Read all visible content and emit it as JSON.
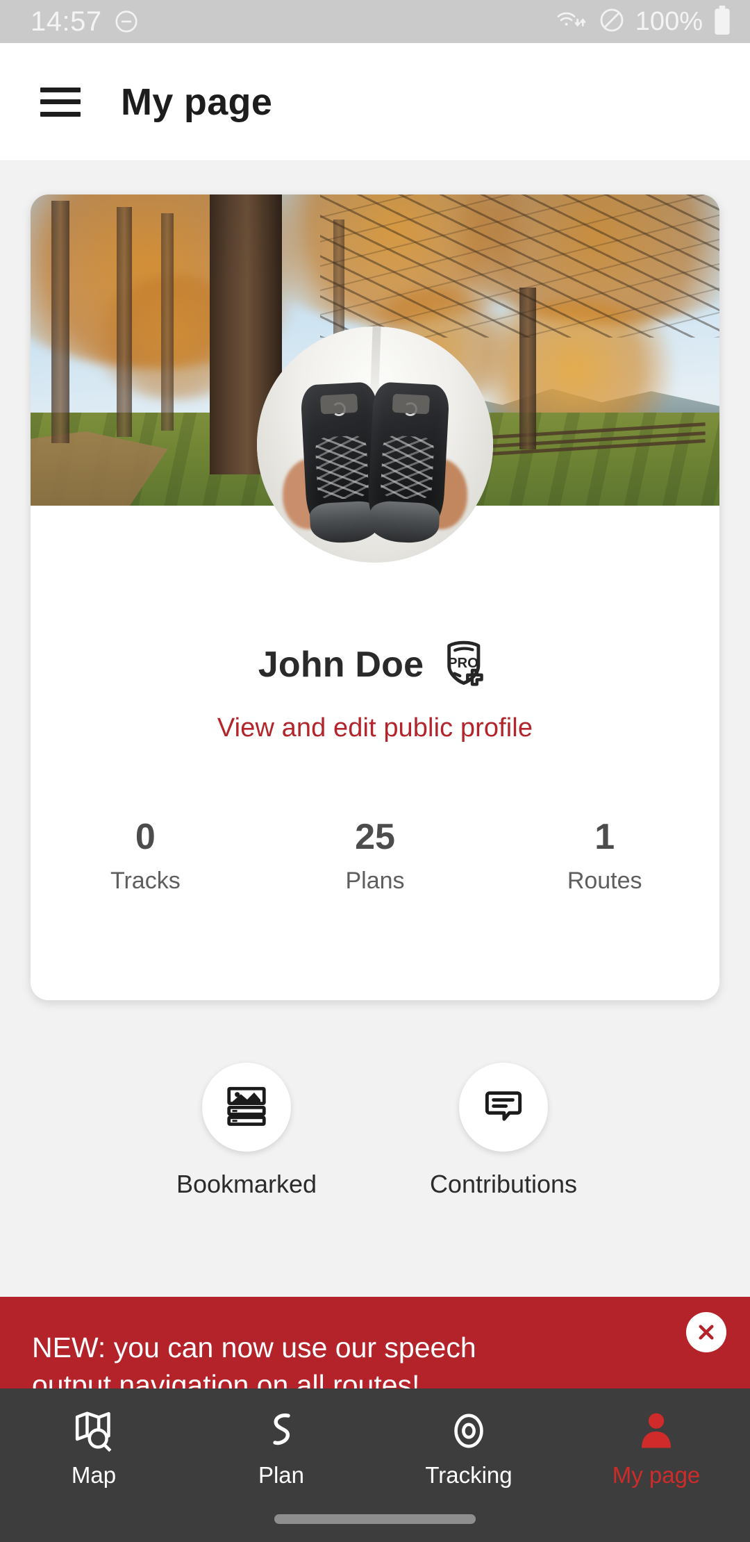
{
  "status_bar": {
    "time": "14:57",
    "dnd_icon": "do-not-disturb-icon",
    "wifi_icon": "wifi-transfer-icon",
    "silent_icon": "mute-circle-slash-icon",
    "battery_percent": "100%",
    "battery_icon": "battery-full-icon",
    "background_color": "#cacaca"
  },
  "app_bar": {
    "menu_icon": "hamburger-menu-icon",
    "title": "My page"
  },
  "profile_card": {
    "cover_photo_alt": "autumn larch forest with path and mountain view",
    "avatar_alt": "hands holding black hiking boots",
    "name": "John Doe",
    "pro_badge": "pro-plus-shield-icon",
    "profile_link": "View and edit public profile",
    "stats": [
      {
        "value": "0",
        "label": "Tracks"
      },
      {
        "value": "25",
        "label": "Plans"
      },
      {
        "value": "1",
        "label": "Routes"
      }
    ]
  },
  "quick_actions": [
    {
      "label": "Bookmarked",
      "icon": "article-list-image-icon"
    },
    {
      "label": "Contributions",
      "icon": "speech-bubble-lines-icon"
    }
  ],
  "banner": {
    "text": "NEW: you can now use our speech output navigation on all routes!",
    "close_icon": "close-x-icon",
    "background_color": "#b5232a",
    "decoration_icon": "key-icon"
  },
  "bottom_nav": {
    "items": [
      {
        "label": "Map",
        "icon": "map-search-icon",
        "active": false
      },
      {
        "label": "Plan",
        "icon": "winding-path-icon",
        "active": false
      },
      {
        "label": "Tracking",
        "icon": "target-circles-icon",
        "active": false
      },
      {
        "label": "My page",
        "icon": "person-icon",
        "active": true
      }
    ],
    "active_color": "#cf2b2b",
    "background_color": "#3d3d3d"
  }
}
